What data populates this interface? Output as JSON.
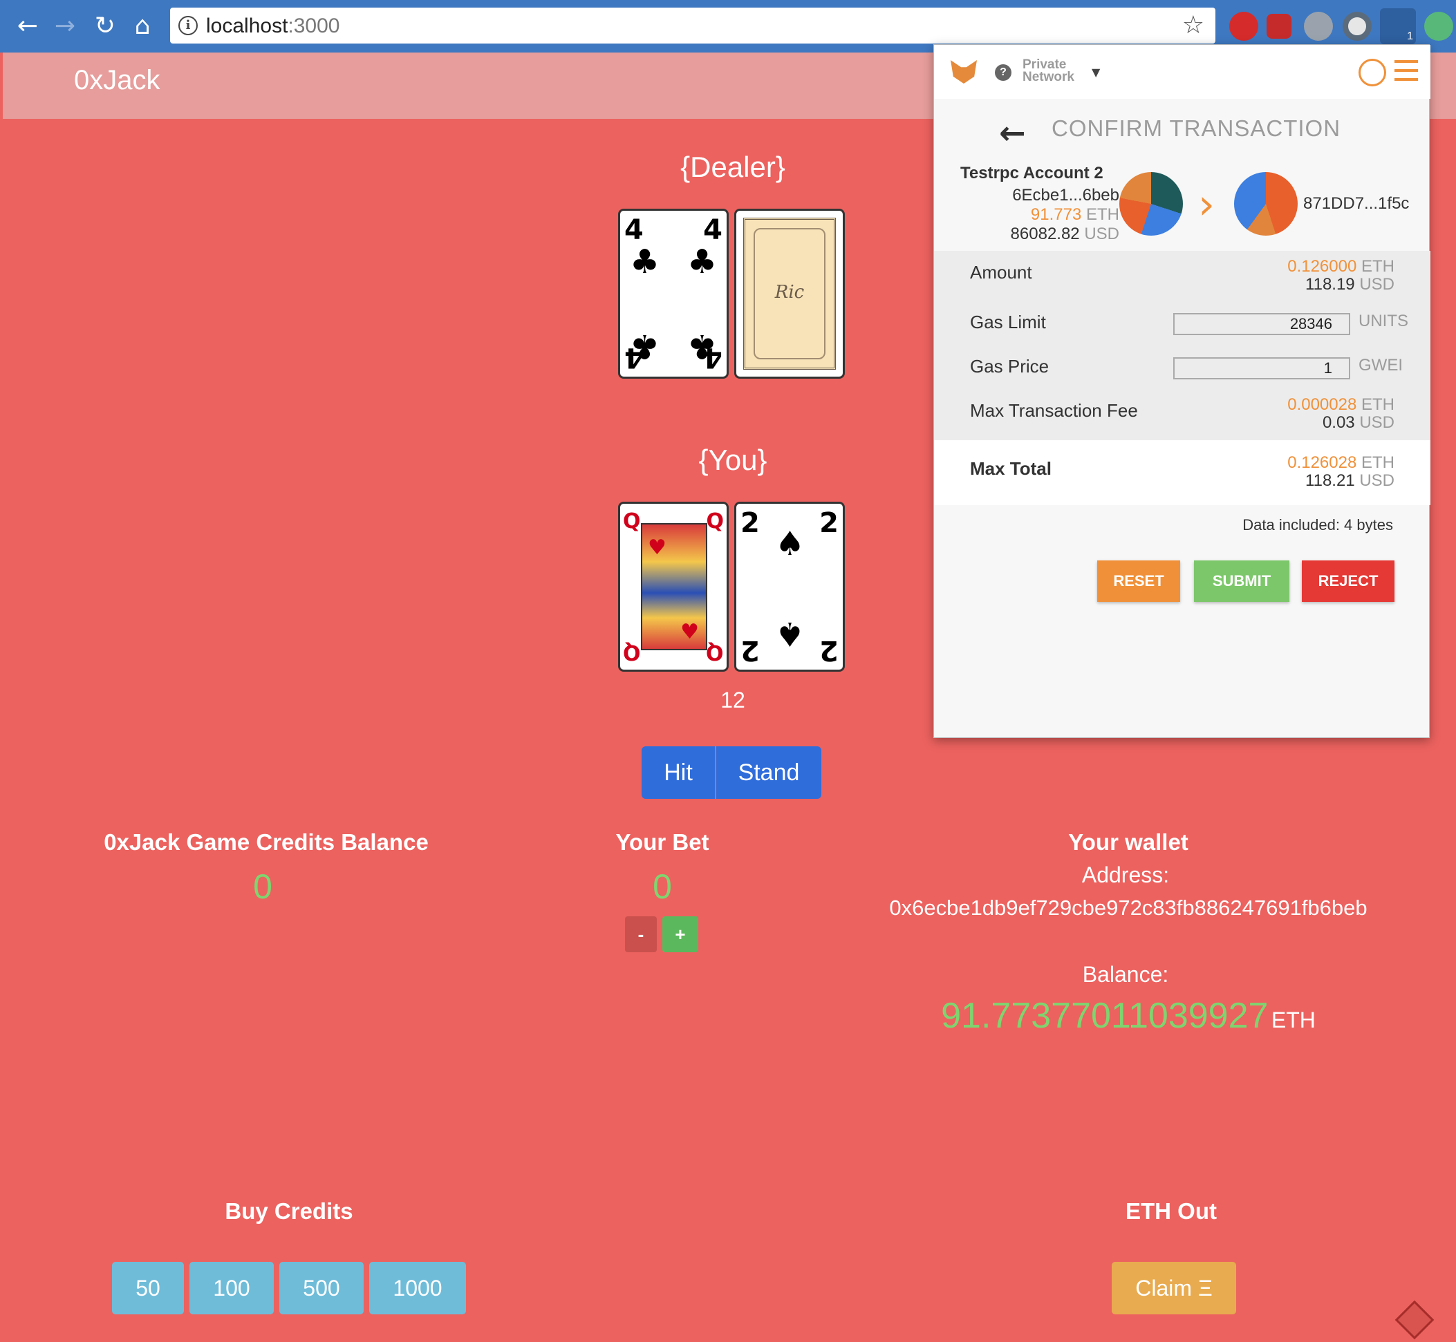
{
  "browser": {
    "url_host": "localhost",
    "url_port": ":3000",
    "extension_badge": "1"
  },
  "app": {
    "brand": "0xJack",
    "dealer_label": "{Dealer}",
    "you_label": "{You}",
    "dealer_cards": [
      {
        "rank": "4",
        "suit": "♣",
        "color": "#000000",
        "face_up": true
      },
      {
        "rank": "",
        "suit": "",
        "face_up": false,
        "back_text": "Ric"
      }
    ],
    "player_cards": [
      {
        "rank": "Q",
        "suit": "♥",
        "color": "#d0021b",
        "face_up": true
      },
      {
        "rank": "2",
        "suit": "♠",
        "color": "#000000",
        "face_up": true
      }
    ],
    "player_score": "12",
    "hit_label": "Hit",
    "stand_label": "Stand",
    "credits_balance_label": "0xJack Game Credits Balance",
    "credits_balance_value": "0",
    "your_bet_label": "Your Bet",
    "your_bet_value": "0",
    "bet_minus": "-",
    "bet_plus": "+",
    "wallet_label": "Your wallet",
    "address_label": "Address:",
    "address_value": "0x6ecbe1db9ef729cbe972c83fb886247691fb6beb",
    "balance_label": "Balance:",
    "balance_value": "91.77377011039927",
    "balance_unit": "ETH",
    "buy_credits_label": "Buy Credits",
    "credit_options": [
      "50",
      "100",
      "500",
      "1000"
    ],
    "eth_out_label": "ETH Out",
    "claim_label": "Claim Ξ"
  },
  "metamask": {
    "network_line1": "Private",
    "network_line2": "Network",
    "title": "CONFIRM TRANSACTION",
    "from_name": "Testrpc Account 2",
    "from_address": "6Ecbe1...6beb",
    "from_eth": "91.773",
    "from_eth_unit": "ETH",
    "from_usd": "86082.82",
    "from_usd_unit": "USD",
    "to_address": "871DD7...1f5c",
    "amount_label": "Amount",
    "amount_eth": "0.126000",
    "amount_usd": "118.19",
    "gas_limit_label": "Gas Limit",
    "gas_limit_value": "28346",
    "gas_limit_unit": "UNITS",
    "gas_price_label": "Gas Price",
    "gas_price_value": "1",
    "gas_price_unit": "GWEI",
    "max_fee_label": "Max Transaction Fee",
    "max_fee_eth": "0.000028",
    "max_fee_usd": "0.03",
    "max_total_label": "Max Total",
    "max_total_eth": "0.126028",
    "max_total_usd": "118.21",
    "eth_unit": "ETH",
    "usd_unit": "USD",
    "data_included": "Data included: 4 bytes",
    "reset_label": "RESET",
    "submit_label": "SUBMIT",
    "reject_label": "REJECT"
  },
  "colors": {
    "page_bg": "#ec625f",
    "header_bg": "#e69d9b",
    "accent_green": "#7ed56f",
    "button_blue": "#2f6ddb",
    "credit_blue": "#6fbcd9",
    "claim_orange": "#e8ab4f",
    "mm_orange": "#f0913a",
    "mm_reset": "#f0913a",
    "mm_submit": "#7dc76b",
    "mm_reject": "#e53935"
  }
}
